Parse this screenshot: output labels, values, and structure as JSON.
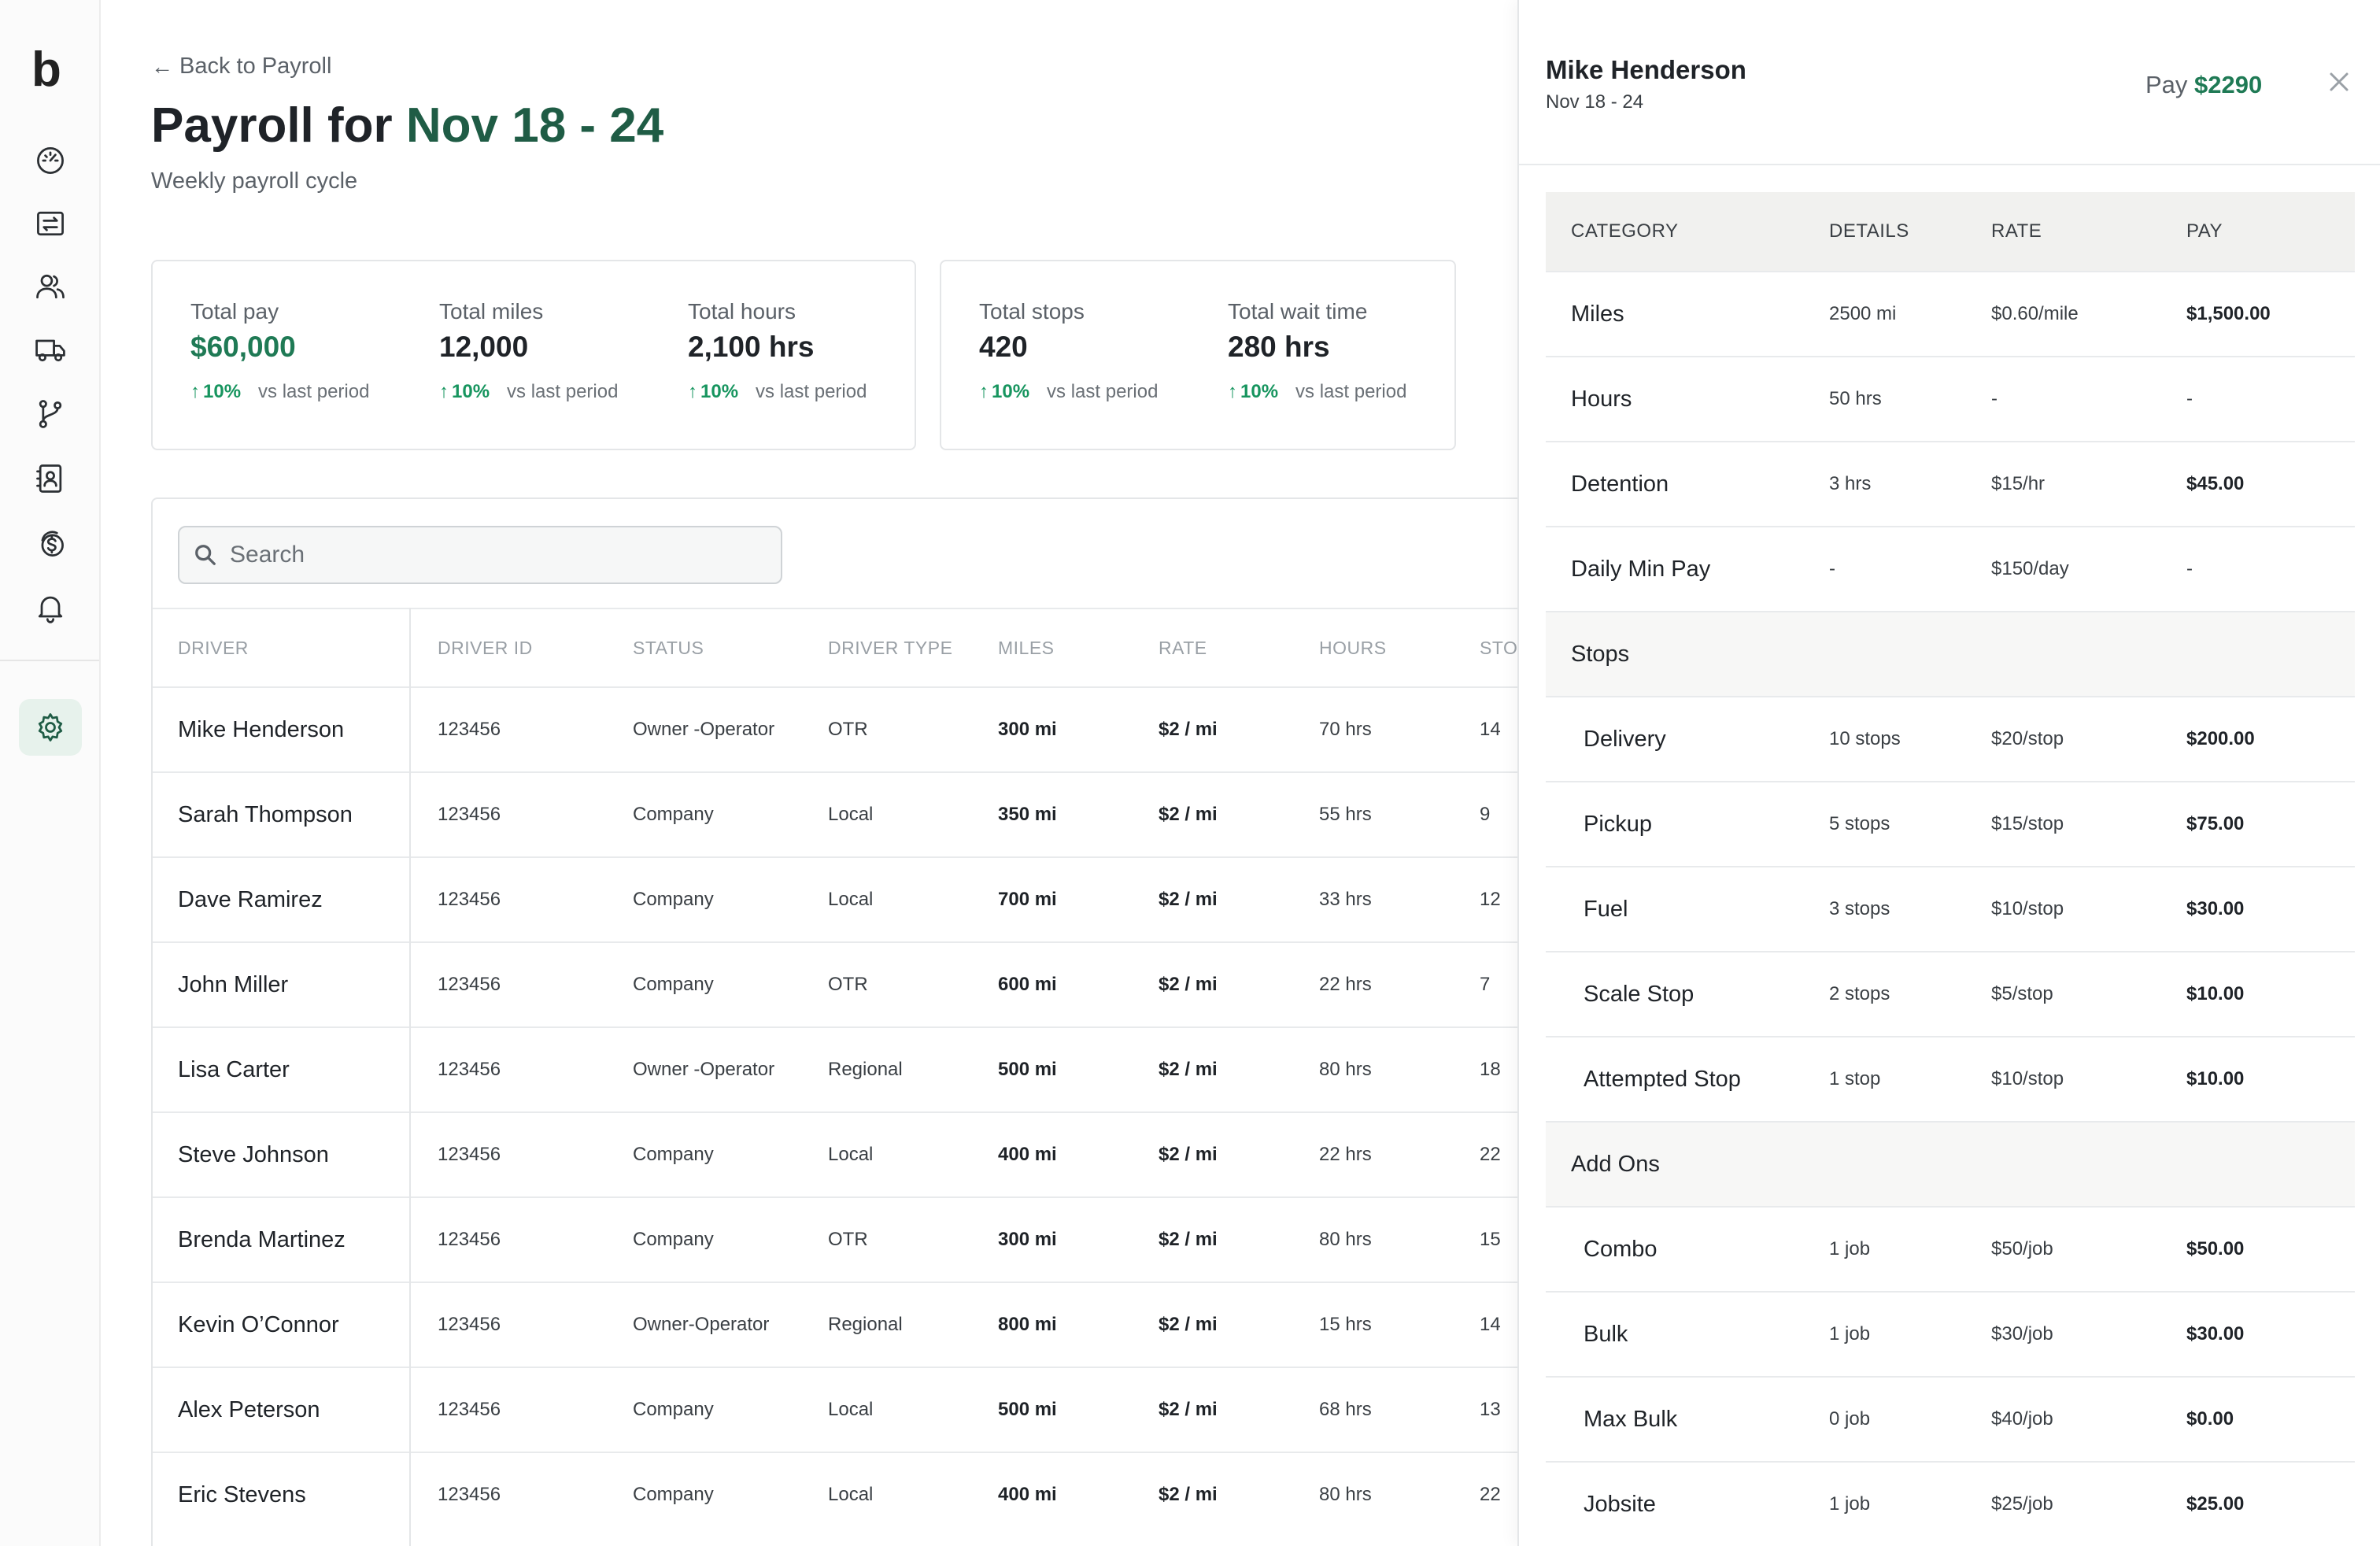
{
  "app": {
    "logo": "b"
  },
  "sidebar": {
    "items": [
      {
        "icon": "gauge-icon"
      },
      {
        "icon": "transfer-icon"
      },
      {
        "icon": "users-icon"
      },
      {
        "icon": "truck-icon"
      },
      {
        "icon": "route-icon"
      },
      {
        "icon": "contacts-icon"
      },
      {
        "icon": "coins-icon"
      },
      {
        "icon": "bell-icon"
      },
      {
        "icon": "gear-icon"
      }
    ]
  },
  "header": {
    "back_label": "Back to Payroll",
    "title_prefix": "Payroll for",
    "title_period": "Nov 18 - 24",
    "subtitle": "Weekly payroll cycle"
  },
  "stats": [
    {
      "label": "Total pay",
      "value": "$60,000",
      "trend": "10%",
      "note": "vs last period"
    },
    {
      "label": "Total miles",
      "value": "12,000",
      "trend": "10%",
      "note": "vs last period"
    },
    {
      "label": "Total hours",
      "value": "2,100 hrs",
      "trend": "10%",
      "note": "vs last period"
    },
    {
      "label": "Total stops",
      "value": "420",
      "trend": "10%",
      "note": "vs last period"
    },
    {
      "label": "Total wait time",
      "value": "280 hrs",
      "trend": "10%",
      "note": "vs last period"
    }
  ],
  "search": {
    "placeholder": "Search"
  },
  "table": {
    "columns": [
      "DRIVER",
      "DRIVER ID",
      "STATUS",
      "DRIVER TYPE",
      "MILES",
      "RATE",
      "HOURS",
      "STO"
    ],
    "rows": [
      {
        "driver": "Mike Henderson",
        "id": "123456",
        "status": "Owner -Operator",
        "type": "OTR",
        "miles": "300 mi",
        "rate": "$2 / mi",
        "hours": "70 hrs",
        "stops": "14"
      },
      {
        "driver": "Sarah Thompson",
        "id": "123456",
        "status": "Company",
        "type": "Local",
        "miles": "350 mi",
        "rate": "$2 / mi",
        "hours": "55 hrs",
        "stops": "9"
      },
      {
        "driver": "Dave Ramirez",
        "id": "123456",
        "status": "Company",
        "type": "Local",
        "miles": "700 mi",
        "rate": "$2 / mi",
        "hours": "33 hrs",
        "stops": "12"
      },
      {
        "driver": "John Miller",
        "id": "123456",
        "status": "Company",
        "type": "OTR",
        "miles": "600 mi",
        "rate": "$2 / mi",
        "hours": "22 hrs",
        "stops": "7"
      },
      {
        "driver": "Lisa Carter",
        "id": "123456",
        "status": "Owner -Operator",
        "type": "Regional",
        "miles": "500 mi",
        "rate": "$2 / mi",
        "hours": "80 hrs",
        "stops": "18"
      },
      {
        "driver": "Steve Johnson",
        "id": "123456",
        "status": "Company",
        "type": "Local",
        "miles": "400 mi",
        "rate": "$2 / mi",
        "hours": "22 hrs",
        "stops": "22"
      },
      {
        "driver": "Brenda Martinez",
        "id": "123456",
        "status": "Company",
        "type": "OTR",
        "miles": "300 mi",
        "rate": "$2 / mi",
        "hours": "80 hrs",
        "stops": "15"
      },
      {
        "driver": "Kevin O’Connor",
        "id": "123456",
        "status": "Owner-Operator",
        "type": "Regional",
        "miles": "800 mi",
        "rate": "$2 / mi",
        "hours": "15 hrs",
        "stops": "14"
      },
      {
        "driver": "Alex Peterson",
        "id": "123456",
        "status": "Company",
        "type": "Local",
        "miles": "500 mi",
        "rate": "$2 / mi",
        "hours": "68 hrs",
        "stops": "13"
      },
      {
        "driver": "Eric Stevens",
        "id": "123456",
        "status": "Company",
        "type": "Local",
        "miles": "400 mi",
        "rate": "$2 / mi",
        "hours": "80 hrs",
        "stops": "22"
      }
    ]
  },
  "panel": {
    "driver_name": "Mike Henderson",
    "period": "Nov 18 - 24",
    "pay_label": "Pay",
    "pay_amount": "$2290",
    "columns": [
      "CATEGORY",
      "DETAILS",
      "RATE",
      "PAY"
    ],
    "rows": [
      {
        "kind": "item",
        "category": "Miles",
        "details": "2500 mi",
        "rate": "$0.60/mile",
        "pay": "$1,500.00"
      },
      {
        "kind": "item",
        "category": "Hours",
        "details": "50 hrs",
        "rate": "-",
        "pay": "-"
      },
      {
        "kind": "item",
        "category": "Detention",
        "details": "3 hrs",
        "rate": "$15/hr",
        "pay": "$45.00"
      },
      {
        "kind": "item",
        "category": "Daily Min Pay",
        "details": "-",
        "rate": "$150/day",
        "pay": "-"
      },
      {
        "kind": "section",
        "category": "Stops"
      },
      {
        "kind": "sub",
        "category": "Delivery",
        "details": "10 stops",
        "rate": "$20/stop",
        "pay": "$200.00"
      },
      {
        "kind": "sub",
        "category": "Pickup",
        "details": "5 stops",
        "rate": "$15/stop",
        "pay": "$75.00"
      },
      {
        "kind": "sub",
        "category": "Fuel",
        "details": "3 stops",
        "rate": "$10/stop",
        "pay": "$30.00"
      },
      {
        "kind": "sub",
        "category": "Scale Stop",
        "details": "2 stops",
        "rate": "$5/stop",
        "pay": "$10.00"
      },
      {
        "kind": "sub",
        "category": "Attempted Stop",
        "details": "1 stop",
        "rate": "$10/stop",
        "pay": "$10.00"
      },
      {
        "kind": "section",
        "category": "Add Ons"
      },
      {
        "kind": "sub",
        "category": "Combo",
        "details": "1 job",
        "rate": "$50/job",
        "pay": "$50.00"
      },
      {
        "kind": "sub",
        "category": "Bulk",
        "details": "1 job",
        "rate": "$30/job",
        "pay": "$30.00"
      },
      {
        "kind": "sub",
        "category": "Max Bulk",
        "details": "0 job",
        "rate": "$40/job",
        "pay": "$0.00"
      },
      {
        "kind": "sub",
        "category": "Jobsite",
        "details": "1 job",
        "rate": "$25/job",
        "pay": "$25.00"
      }
    ]
  },
  "colors": {
    "brand": "#1f5c45",
    "positive": "#17955f",
    "money": "#1f7a55"
  }
}
